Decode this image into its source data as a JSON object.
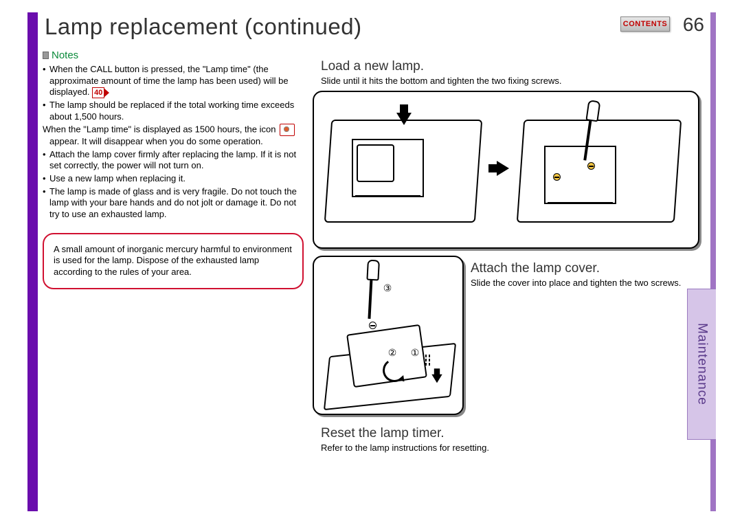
{
  "page": {
    "title": "Lamp replacement (continued)",
    "number": "66",
    "contents_label": "CONTENTS",
    "section_tab": "Maintenance"
  },
  "notes": {
    "heading": "Notes",
    "items": [
      "When the CALL button is pressed, the \"Lamp time\" (the approximate amount of time the lamp has been used) will be displayed.",
      "The lamp should be replaced if the total working time exceeds about 1,500 hours.",
      "When the \"Lamp time\" is displayed as 1500 hours, the icon         appear. It will disappear when you do some operation.",
      "Attach the lamp cover firmly after replacing the lamp. If it is not set correctly, the power will not turn on.",
      "Use a new lamp when replacing it.",
      "The lamp is made of glass and is very fragile. Do not touch the lamp with your bare hands and do not jolt or damage it. Do not try to use an exhausted lamp."
    ],
    "page_ref": "40",
    "warning": "A small amount of inorganic mercury harmful to environment is used for the lamp. Dispose of the exhausted lamp according to the rules of your area."
  },
  "steps": {
    "s4": {
      "title": "Load a new lamp.",
      "desc": "Slide until it hits the bottom and tighten the two fixing screws."
    },
    "s5": {
      "title": "Attach the lamp cover.",
      "desc": "Slide the cover into place and tighten the two screws."
    },
    "s6": {
      "title": "Reset the lamp timer.",
      "desc": "Refer to the lamp instructions for resetting."
    }
  }
}
